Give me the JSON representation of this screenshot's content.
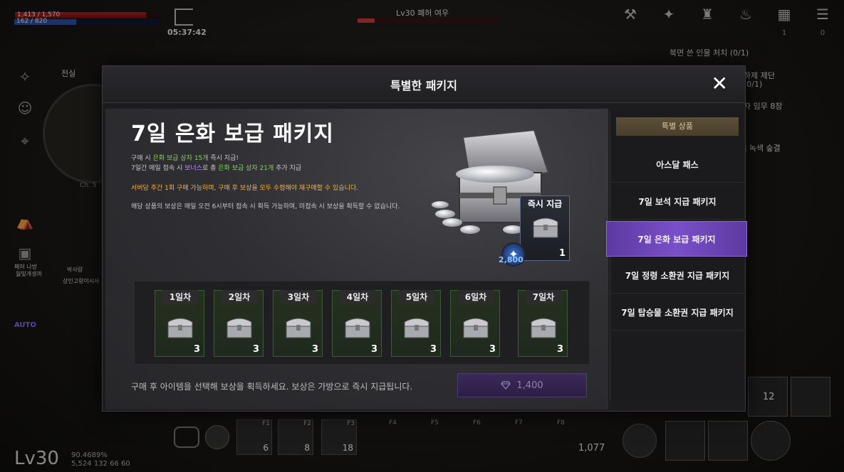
{
  "hud": {
    "hp_text": "1,413 / 1,570",
    "mp_text": "162 / 820",
    "timer": "05:37:42",
    "level_name": "Lv30 폐허 여우",
    "hp_fill": 0.9,
    "top_icon_counts": [
      "1",
      "0"
    ],
    "quest_lines": [
      "북면 쓴 인물 처치 (0/1)",
      "하제 제단",
      "(0/1)",
      "자 임무 8장",
      "] 녹색 숲결"
    ],
    "side_labels": [
      "전실",
      "Ch. 5",
      "폐허 나방",
      "월빛개생까",
      "박사랑",
      "상인고랑이시사"
    ],
    "auto": "AUTO",
    "bottom_level": "Lv30",
    "exp": "90.4689%",
    "stats": [
      "5,524",
      "132",
      "66",
      "60"
    ],
    "slots": [
      {
        "key": "F1",
        "count": "6"
      },
      {
        "key": "F2",
        "count": "8"
      },
      {
        "key": "F3",
        "count": "18"
      }
    ],
    "fkeys": [
      "F4",
      "F5",
      "F6",
      "F7",
      "F8"
    ],
    "arrow_count": "1,077",
    "skill_count": "12"
  },
  "modal": {
    "title": "특별한 패키지",
    "close": "✕",
    "package_title": "7일 은화 보급 패키지",
    "desc1_a": "구매 시 ",
    "desc1_b": "은화 보급 상자 15개",
    "desc1_c": " 즉시 지급!",
    "desc2_a": "7일간 매일 접속 시 ",
    "desc2_b": "보너스",
    "desc2_c": "로 총 ",
    "desc2_d": "은화 보급 상자 21개",
    "desc2_e": " 추가 지급",
    "warning": "서버당 주간 1회 구매 가능하며, 구매 후 보상을 모두 수령해야 재구매할 수 있습니다.",
    "note": "해당 상품의 보상은 매일 오전 6시부터 접속 시 획득 가능하며, 미접속 시 보상을 획득할 수 없습니다.",
    "instant_label": "즉시 지급",
    "instant_count": "1",
    "bonus_amount": "2,800",
    "days": [
      {
        "label": "1일차",
        "count": "3"
      },
      {
        "label": "2일차",
        "count": "3"
      },
      {
        "label": "3일차",
        "count": "3"
      },
      {
        "label": "4일차",
        "count": "3"
      },
      {
        "label": "5일차",
        "count": "3"
      },
      {
        "label": "6일차",
        "count": "3"
      },
      {
        "label": "7일차",
        "count": "3"
      }
    ],
    "footer": "구매 후 아이템을 선택해 보상을 획득하세요. 보상은 가방으로 즉시 지급됩니다.",
    "price": "1,400"
  },
  "side": {
    "category": "특별 상품",
    "items": [
      {
        "label": "아스달 패스"
      },
      {
        "label": "7일 보석 지급 패키지"
      },
      {
        "label": "7일 은화 보급 패키지"
      },
      {
        "label": "7일 정령 소환권 지급 패키지"
      },
      {
        "label": "7일 탑승물 소환권 지급 패키지"
      }
    ],
    "active_index": 2
  },
  "colors": {
    "accent_purple": "#7a4fc9",
    "highlight_green": "#7ed957",
    "warning_orange": "#f2b340",
    "hp_red": "#b22222"
  }
}
